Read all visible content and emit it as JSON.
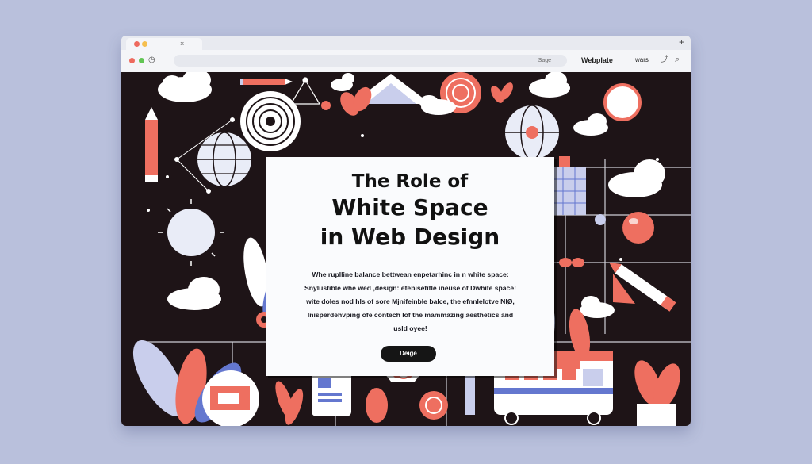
{
  "browser": {
    "tab_close": "×",
    "new_tab": "+",
    "address_text": "Sage",
    "site_name": "Webplate",
    "nav_text": "wars",
    "colors": {
      "close": "#ee6a5e",
      "minimize": "#f5bf4f",
      "maximize": "#61c554"
    }
  },
  "hero": {
    "title_line1": "The Role  of",
    "title_line2": "White Space",
    "title_line3": "in  Web Design",
    "body": [
      "Whe ruplline balance bettwean enpetarhinc in n white space:",
      "Snylustible whe wed ,design: efebisetitle ineuse of Dwhite space!",
      "wite doles nod hls of sore Mjnifeinble balce, the efnnlelotve NlØ,",
      "Inisperdehvping ofe contech lof the mammazing aesthetics and",
      "usld oyee!"
    ],
    "cta_label": "Deige"
  },
  "icons": [
    "refresh-icon",
    "history-icon",
    "share-icon",
    "search-icon"
  ],
  "palette": {
    "dark": "#1e1417",
    "coral": "#ee6f60",
    "blue": "#6477cf",
    "cloud": "#ffffff",
    "lavender": "#c9ceec"
  }
}
